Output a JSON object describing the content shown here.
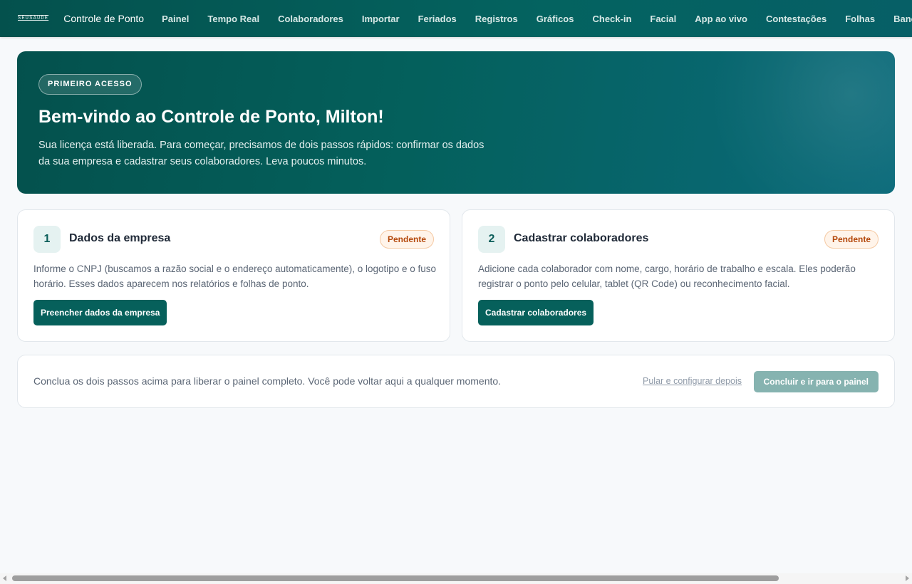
{
  "brand": {
    "logo_text": "SEUSAUDE",
    "title": "Controle de Ponto"
  },
  "nav": {
    "items": [
      "Painel",
      "Tempo Real",
      "Colaboradores",
      "Importar",
      "Feriados",
      "Registros",
      "Gráficos",
      "Check-in",
      "Facial",
      "App ao vivo",
      "Contestações",
      "Folhas",
      "Banco Horas"
    ]
  },
  "hero": {
    "badge": "PRIMEIRO ACESSO",
    "title": "Bem-vindo ao Controle de Ponto, Milton!",
    "subtitle": "Sua licença está liberada. Para começar, precisamos de dois passos rápidos: confirmar os dados da sua empresa e cadastrar seus colaboradores. Leva poucos minutos."
  },
  "steps": [
    {
      "number": "1",
      "title": "Dados da empresa",
      "status": "Pendente",
      "description": "Informe o CNPJ (buscamos a razão social e o endereço automaticamente), o logotipo e o fuso horário. Esses dados aparecem nos relatórios e folhas de ponto.",
      "button_label": "Preencher dados da empresa"
    },
    {
      "number": "2",
      "title": "Cadastrar colaboradores",
      "status": "Pendente",
      "description": "Adicione cada colaborador com nome, cargo, horário de trabalho e escala. Eles poderão registrar o ponto pelo celular, tablet (QR Code) ou reconhecimento facial.",
      "button_label": "Cadastrar colaboradores"
    }
  ],
  "finish": {
    "text": "Conclua os dois passos acima para liberar o painel completo. Você pode voltar aqui a qualquer momento.",
    "skip_label": "Pular e configurar depois",
    "finish_label": "Concluir e ir para o painel"
  },
  "colors": {
    "primary": "#06605b",
    "pending_text": "#b4480b",
    "pending_bg": "#fff4ea",
    "disabled_button": "#86b3b0"
  }
}
